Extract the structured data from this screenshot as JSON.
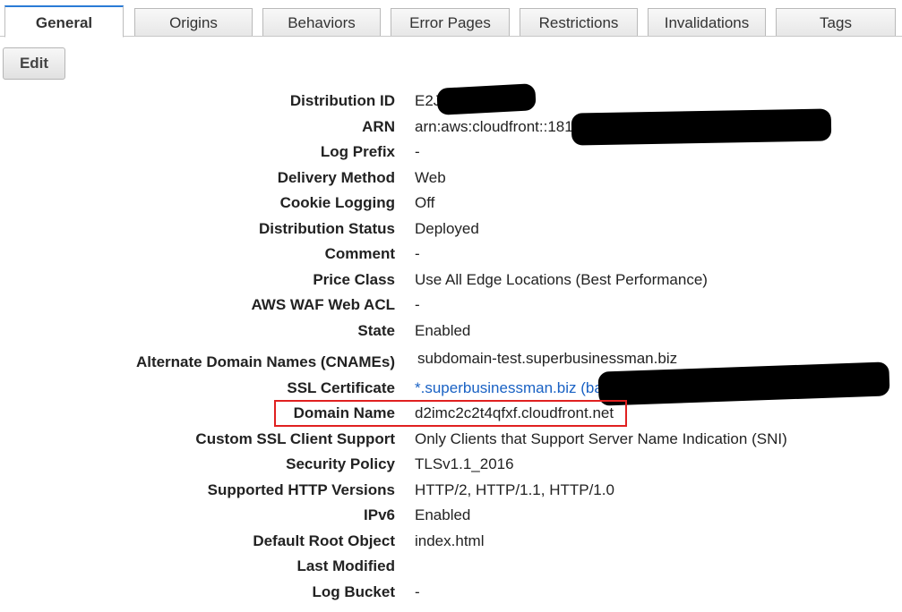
{
  "tabs": [
    {
      "label": "General",
      "active": true
    },
    {
      "label": "Origins"
    },
    {
      "label": "Behaviors"
    },
    {
      "label": "Error Pages"
    },
    {
      "label": "Restrictions"
    },
    {
      "label": "Invalidations"
    },
    {
      "label": "Tags"
    }
  ],
  "toolbar": {
    "edit_label": "Edit"
  },
  "details": {
    "distribution_id": {
      "label": "Distribution ID",
      "value": "E2J...UIGG"
    },
    "arn": {
      "label": "ARN",
      "value": "arn:aws:cloudfront::181.........UIGG"
    },
    "log_prefix": {
      "label": "Log Prefix",
      "value": "-"
    },
    "delivery_method": {
      "label": "Delivery Method",
      "value": "Web"
    },
    "cookie_logging": {
      "label": "Cookie Logging",
      "value": "Off"
    },
    "distribution_status": {
      "label": "Distribution Status",
      "value": "Deployed"
    },
    "comment": {
      "label": "Comment",
      "value": "-"
    },
    "price_class": {
      "label": "Price Class",
      "value": "Use All Edge Locations (Best Performance)"
    },
    "waf_acl": {
      "label": "AWS WAF Web ACL",
      "value": "-"
    },
    "state": {
      "label": "State",
      "value": "Enabled"
    },
    "cnames": {
      "label": "Alternate Domain Names (CNAMEs)",
      "value": "subdomain-test.superbusinessman.biz"
    },
    "ssl_certificate": {
      "label": "SSL Certificate",
      "value": "*.superbusinessman.biz (ba"
    },
    "domain_name": {
      "label": "Domain Name",
      "value": "d2imc2c2t4qfxf.cloudfront.net"
    },
    "custom_ssl": {
      "label": "Custom SSL Client Support",
      "value": "Only Clients that Support Server Name Indication (SNI)"
    },
    "security_policy": {
      "label": "Security Policy",
      "value": "TLSv1.1_2016"
    },
    "http_versions": {
      "label": "Supported HTTP Versions",
      "value": "HTTP/2, HTTP/1.1, HTTP/1.0"
    },
    "ipv6": {
      "label": "IPv6",
      "value": "Enabled"
    },
    "default_root": {
      "label": "Default Root Object",
      "value": "index.html"
    },
    "last_modified": {
      "label": "Last Modified",
      "value": ""
    },
    "log_bucket": {
      "label": "Log Bucket",
      "value": "-"
    }
  },
  "colors": {
    "link": "#1a62c4",
    "highlight": "#e02020",
    "active_tab_accent": "#2b7bd6"
  }
}
